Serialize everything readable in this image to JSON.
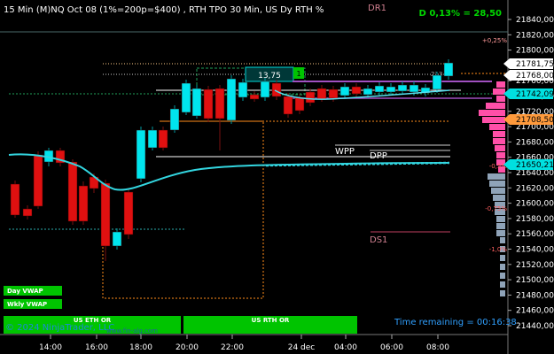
{
  "header": {
    "title": "15 Min (M)NQ Oct 08 (1%=200p=$400) , RTH TPO 30 Min, US Dy RTH %",
    "dr1_label": "DR1",
    "delta_readout": "D 0,13% = 28,50"
  },
  "price_axis": {
    "ticks": [
      "21840,00",
      "21820,00",
      "21800,00",
      "21780,00",
      "21760,00",
      "21740,00",
      "21720,00",
      "21700,00",
      "21680,00",
      "21660,00",
      "21640,00",
      "21620,00",
      "21600,00",
      "21580,00",
      "21560,00",
      "21540,00",
      "21520,00",
      "21500,00",
      "21480,00",
      "21460,00",
      "21440,00"
    ],
    "markers": [
      {
        "label": "21781,75",
        "color": "#ffffff",
        "text_color": "#000000"
      },
      {
        "label": "21768,00",
        "color": "#ffffff",
        "text_color": "#000000"
      },
      {
        "label": "21742,09",
        "color": "#00e0e0",
        "text_color": "#000000"
      },
      {
        "label": "21708,50",
        "color": "#ff9a3c",
        "text_color": "#000000"
      },
      {
        "label": "21650,21",
        "color": "#00e0e0",
        "text_color": "#000000"
      }
    ]
  },
  "time_axis": {
    "ticks": [
      "14:00",
      "16:00",
      "18:00",
      "20:00",
      "22:00",
      "24 dec",
      "04:00",
      "06:00",
      "08:00"
    ]
  },
  "annotations": {
    "pct_top": "+0,25%",
    "pct_mid1": "-0,5%",
    "pct_mid2": "-0,75%",
    "pct_low": "-1,0%",
    "range_box_value": "13,75",
    "wpp": "WPP",
    "dpp": "DPP",
    "ds1": "DS1",
    "green_marker": "1",
    "small_label": "213"
  },
  "buttons": {
    "day_vwap": "Day VWAP",
    "wkly_vwap": "Wkly VWAP",
    "us_eth_or": "US ETH OR",
    "us_rth_or": "US RTH OR"
  },
  "footer": {
    "copyright": "© 2024 NinjaTrader, LLC",
    "watermark": "www.fin-alg.com",
    "time_remaining": "Time remaining = 00:16:38"
  },
  "colors": {
    "bull": "#00e5ee",
    "bear": "#e01010",
    "vwap": "#33d6e0",
    "orange": "#ff8c1a",
    "magenta": "#ff4fa8",
    "green": "#00c400"
  }
}
